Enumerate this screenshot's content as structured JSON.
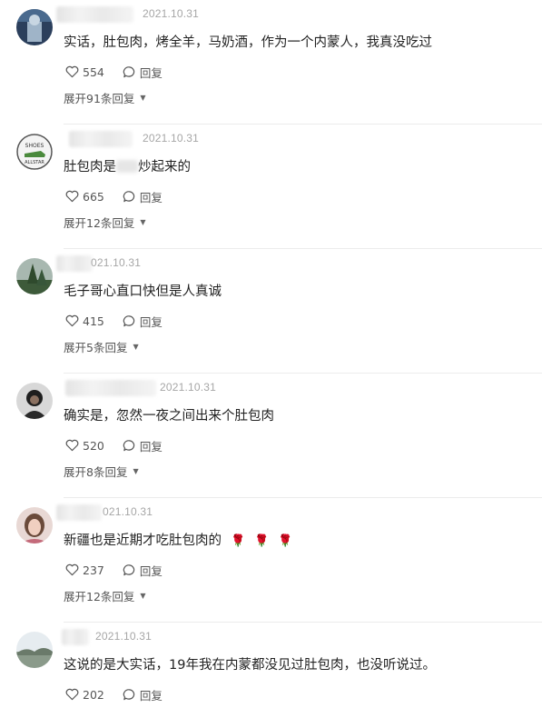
{
  "comments": [
    {
      "date": "2021.10.31",
      "text": "实话，肚包肉，烤全羊，马奶酒，作为一个内蒙人，我真没吃过",
      "likes": "554",
      "reply_label": "回复",
      "expand_label": "展开91条回复"
    },
    {
      "date": "2021.10.31",
      "text_before": "肚包肉是",
      "text_after": "炒起来的",
      "likes": "665",
      "reply_label": "回复",
      "expand_label": "展开12条回复"
    },
    {
      "date": "021.10.31",
      "text": "毛子哥心直口快但是人真诚",
      "likes": "415",
      "reply_label": "回复",
      "expand_label": "展开5条回复"
    },
    {
      "date": "2021.10.31",
      "text": "确实是，忽然一夜之间出来个肚包肉",
      "likes": "520",
      "reply_label": "回复",
      "expand_label": "展开8条回复"
    },
    {
      "date": "021.10.31",
      "text": "新疆也是近期才吃肚包肉的",
      "emoji": "🌹",
      "likes": "237",
      "reply_label": "回复",
      "expand_label": "展开12条回复"
    },
    {
      "date": "2021.10.31",
      "text": "这说的是大实话，19年我在内蒙都没见过肚包肉，也没听说过。",
      "likes": "202",
      "reply_label": "回复"
    }
  ],
  "icons": {
    "like": "heart-outline-icon",
    "reply": "speech-bubble-icon",
    "expand": "caret-down-icon"
  }
}
